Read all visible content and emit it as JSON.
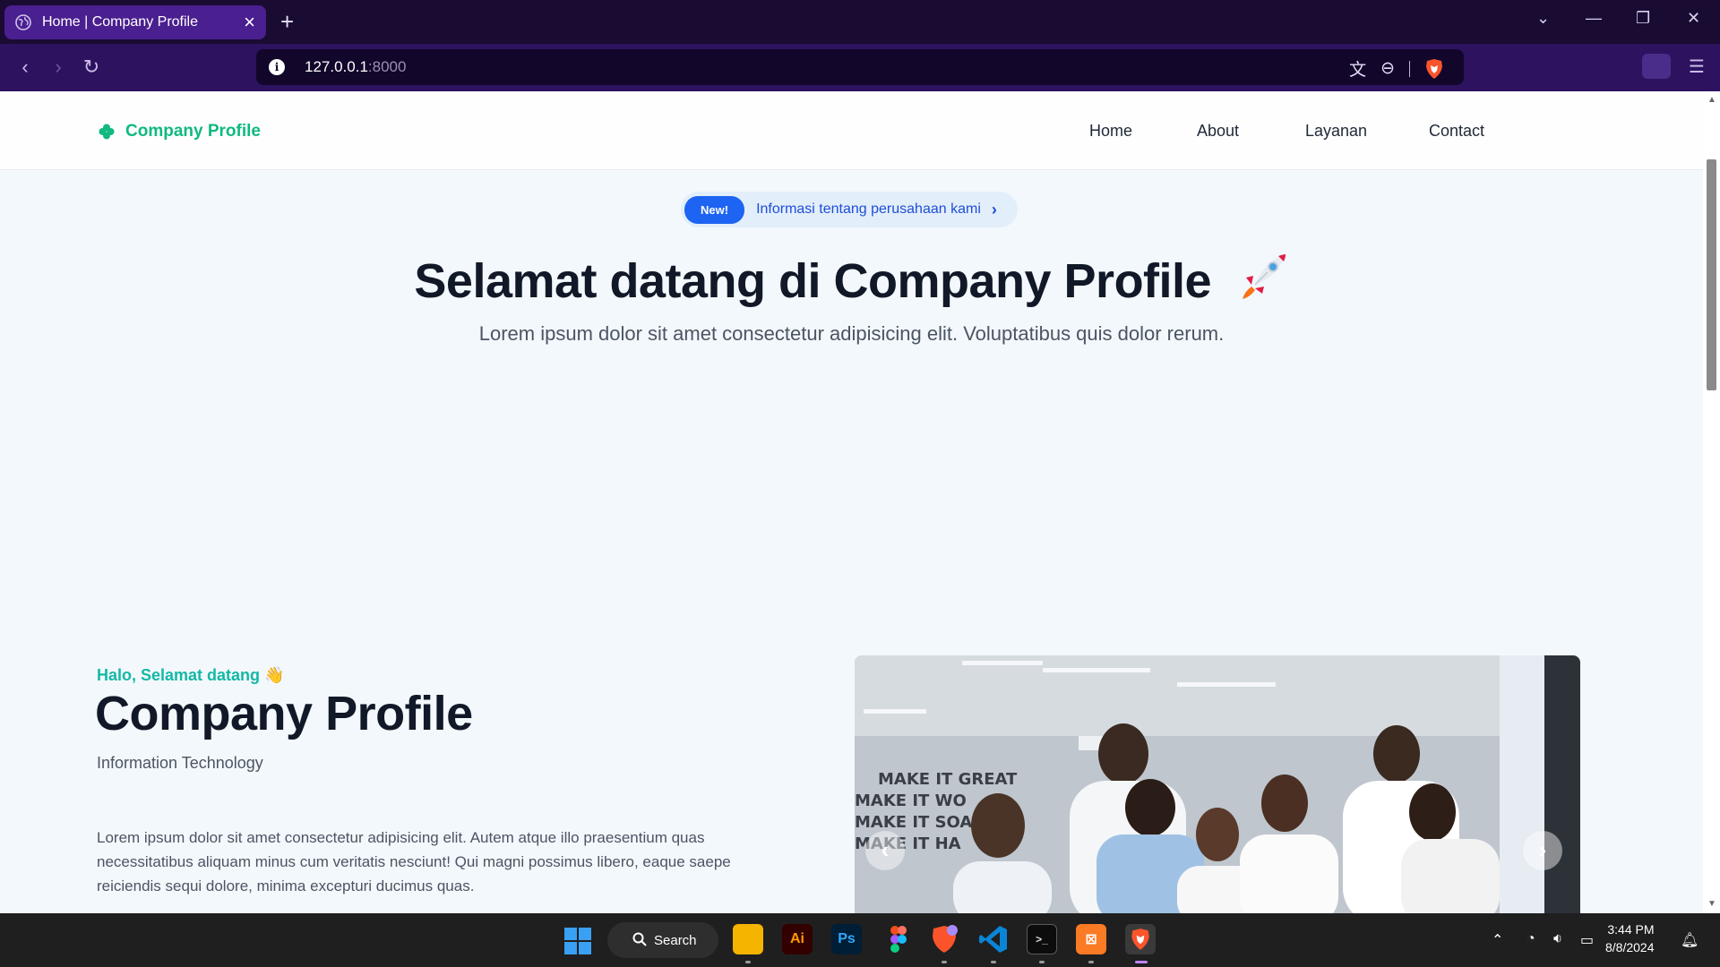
{
  "browser": {
    "tab_title": "Home | Company Profile",
    "url_host": "127.0.0.1",
    "url_port": ":8000"
  },
  "navbar": {
    "brand": "Company Profile",
    "links": [
      "Home",
      "About",
      "Layanan",
      "Contact"
    ]
  },
  "announcement": {
    "badge": "New!",
    "text": "Informasi tentang perusahaan kami"
  },
  "hero": {
    "title": "Selamat datang di Company Profile",
    "subtitle": "Lorem ipsum dolor sit amet consectetur adipisicing elit. Voluptatibus quis dolor rerum."
  },
  "about": {
    "greeting": "Halo, Selamat datang 👋",
    "title_part1": "Company",
    "title_part2": "Profile",
    "category": "Information Technology",
    "paragraph": "Lorem ipsum dolor sit amet consectetur adipisicing elit. Autem atque illo praesentium quas necessitatibus aliquam minus cum veritatis nesciunt! Qui magni possimus libero, eaque saepe reiciendis sequi dolore, minima excepturi ducimus quas."
  },
  "carousel": {
    "wall_text": [
      "MAKE IT GREAT",
      "MAKE IT WO",
      "MAKE IT SOAR",
      "MAKE IT HA"
    ]
  },
  "taskbar": {
    "search_label": "Search",
    "time": "3:44 PM",
    "date": "8/8/2024",
    "apps": [
      "file-explorer",
      "illustrator",
      "photoshop",
      "figma",
      "brave-nightly",
      "vscode",
      "terminal",
      "xampp",
      "brave"
    ]
  },
  "colors": {
    "accent_green": "#10b981",
    "accent_blue": "#1d64f2",
    "browser_purple": "#2d1260"
  }
}
